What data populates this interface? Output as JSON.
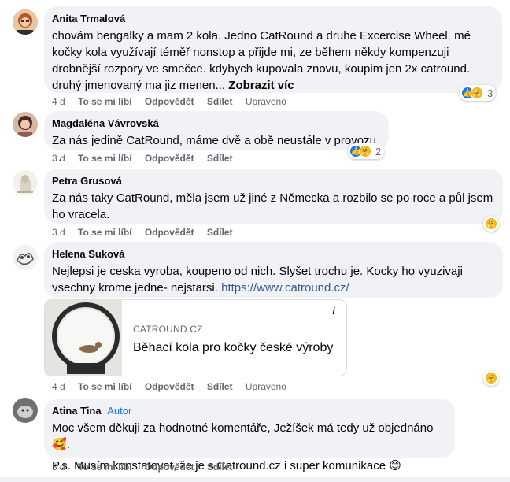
{
  "comments": [
    {
      "author": "Anita Trmalová",
      "text": "chovám bengalky a mam 2 kola. Jedno CatRound a druhe Excercise Wheel. mé kočky kola využívají téměř nonstop a přijde mi, ze během někdy kompenzuji drobnější rozpory ve smečce. kdybych kupovala znovu, koupim jen 2x catround. druhý jmenovaný ma jiz menen...",
      "more": "Zobrazit víc",
      "time": "4 d",
      "like": "To se mi líbí",
      "reply": "Odpovědět",
      "share": "Sdílet",
      "edited": "Upraveno",
      "reaction_count": "3"
    },
    {
      "author": "Magdaléna Vávrovská",
      "text": "Za nás jedině CatRound, máme dvě a obě neustále v provozu ...",
      "time": "3 d",
      "like": "To se mi líbí",
      "reply": "Odpovědět",
      "share": "Sdílet",
      "reaction_count": "2"
    },
    {
      "author": "Petra Grusová",
      "text": "Za nás taky CatRound, měla jsem už jiné z Německa a rozbilo se po roce a půl jsem ho vracela.",
      "time": "3 d",
      "like": "To se mi líbí",
      "reply": "Odpovědět",
      "share": "Sdílet"
    },
    {
      "author": "Helena Suková",
      "text": "Nejlepsi je ceska vyroba, koupeno od nich. Slyšet trochu je. Kocky ho vyuzivaji vsechny krome jedne- nejstarsi.",
      "link": "https://www.catround.cz/",
      "preview_domain": "CATROUND.CZ",
      "preview_title": "Běhací kola pro kočky české výroby",
      "time": "4 d",
      "like": "To se mi líbí",
      "reply": "Odpovědět",
      "share": "Sdílet",
      "edited": "Upraveno"
    },
    {
      "author": "Atina Tina",
      "badge": "Autor",
      "text1": "Moc všem děkuji za hodnotné komentáře, Ježíšek má tedy už objednáno",
      "text2": "P.s. Musím konstatovat, že je s Catround.cz i super komunikace",
      "time": "3 d",
      "like": "To se mi líbí",
      "reply": "Odpovědět",
      "share": "Sdílet"
    }
  ],
  "colors": {
    "bubble": "#f0f2f5",
    "link": "#385898",
    "author_badge": "#1877f2",
    "meta": "#65676b"
  },
  "icons": [
    "like-reaction-icon",
    "care-reaction-icon",
    "info-icon"
  ]
}
